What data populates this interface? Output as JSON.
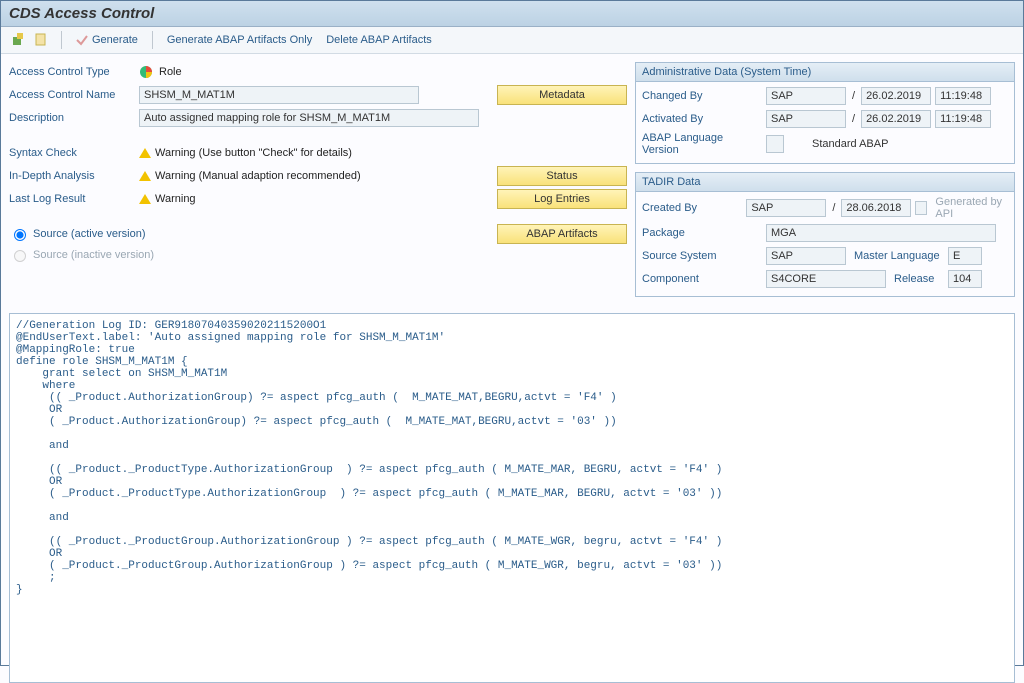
{
  "title": "CDS Access Control",
  "toolbar": {
    "generate": "Generate",
    "gen_abap_only": "Generate ABAP Artifacts Only",
    "delete_abap": "Delete ABAP Artifacts"
  },
  "form": {
    "access_control_type_label": "Access Control Type",
    "access_control_type_value": "Role",
    "access_control_name_label": "Access Control Name",
    "access_control_name_value": "SHSM_M_MAT1M",
    "description_label": "Description",
    "description_value": "Auto assigned mapping role for SHSM_M_MAT1M",
    "syntax_check_label": "Syntax Check",
    "syntax_check_value": "Warning (Use button \"Check\" for details)",
    "in_depth_label": "In-Depth Analysis",
    "in_depth_value": "Warning (Manual adaption recommended)",
    "last_log_label": "Last Log Result",
    "last_log_value": "Warning",
    "metadata_btn": "Metadata",
    "status_btn": "Status",
    "log_entries_btn": "Log Entries",
    "abap_artifacts_btn": "ABAP Artifacts",
    "source_active": "Source (active version)",
    "source_inactive": "Source (inactive version)"
  },
  "admin_panel": {
    "title": "Administrative Data (System Time)",
    "changed_by_label": "Changed By",
    "changed_by_value": "SAP",
    "changed_on_date": "26.02.2019",
    "changed_on_time": "11:19:48",
    "activated_by_label": "Activated By",
    "activated_by_value": "SAP",
    "activated_on_date": "26.02.2019",
    "activated_on_time": "11:19:48",
    "abap_lang_label": "ABAP Language Version",
    "abap_lang_value": "Standard ABAP"
  },
  "tadir_panel": {
    "title": "TADIR Data",
    "created_by_label": "Created By",
    "created_by_value": "SAP",
    "created_on_date": "28.06.2018",
    "generated_by_api": "Generated by API",
    "package_label": "Package",
    "package_value": "MGA",
    "source_system_label": "Source System",
    "source_system_value": "SAP",
    "master_language_label": "Master Language",
    "master_language_value": "E",
    "component_label": "Component",
    "component_value": "S4CORE",
    "release_label": "Release",
    "release_value": "104"
  },
  "source_code": "//Generation Log ID: GER918070403590202115200O1\n@EndUserText.label: 'Auto assigned mapping role for SHSM_M_MAT1M'\n@MappingRole: true\ndefine role SHSM_M_MAT1M {\n    grant select on SHSM_M_MAT1M\n    where\n     (( _Product.AuthorizationGroup) ?= aspect pfcg_auth (  M_MATE_MAT,BEGRU,actvt = 'F4' )\n     OR\n     ( _Product.AuthorizationGroup) ?= aspect pfcg_auth (  M_MATE_MAT,BEGRU,actvt = '03' ))\n\n     and\n\n     (( _Product._ProductType.AuthorizationGroup  ) ?= aspect pfcg_auth ( M_MATE_MAR, BEGRU, actvt = 'F4' )\n     OR\n     ( _Product._ProductType.AuthorizationGroup  ) ?= aspect pfcg_auth ( M_MATE_MAR, BEGRU, actvt = '03' ))\n\n     and\n\n     (( _Product._ProductGroup.AuthorizationGroup ) ?= aspect pfcg_auth ( M_MATE_WGR, begru, actvt = 'F4' )\n     OR\n     ( _Product._ProductGroup.AuthorizationGroup ) ?= aspect pfcg_auth ( M_MATE_WGR, begru, actvt = '03' ))\n     ;\n}"
}
